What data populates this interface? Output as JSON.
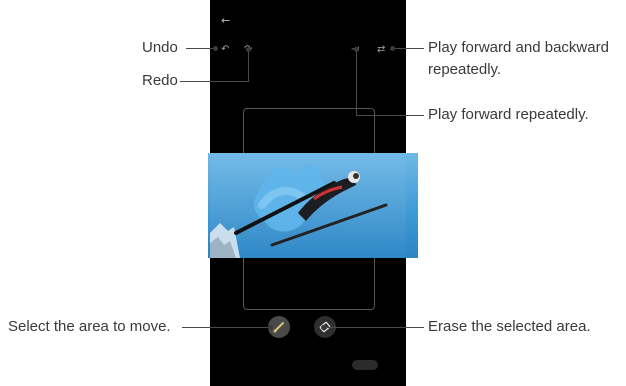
{
  "callouts": {
    "undo": "Undo",
    "redo": "Redo",
    "play_fb": "Play forward and backward",
    "play_fb_line2": "repeatedly.",
    "play_forward": "Play forward repeatedly.",
    "select_area": "Select the area to move.",
    "erase_area": "Erase the selected area."
  },
  "icons": {
    "back": "back-arrow-icon",
    "undo": "undo-icon",
    "redo": "redo-icon",
    "play_forward": "play-forward-icon",
    "play_fb": "repeat-icon",
    "brush": "brush-icon",
    "eraser": "eraser-icon"
  },
  "colors": {
    "sky": "#3a96d2",
    "streak": "#5fb0e6",
    "phone_bg": "#000000"
  }
}
